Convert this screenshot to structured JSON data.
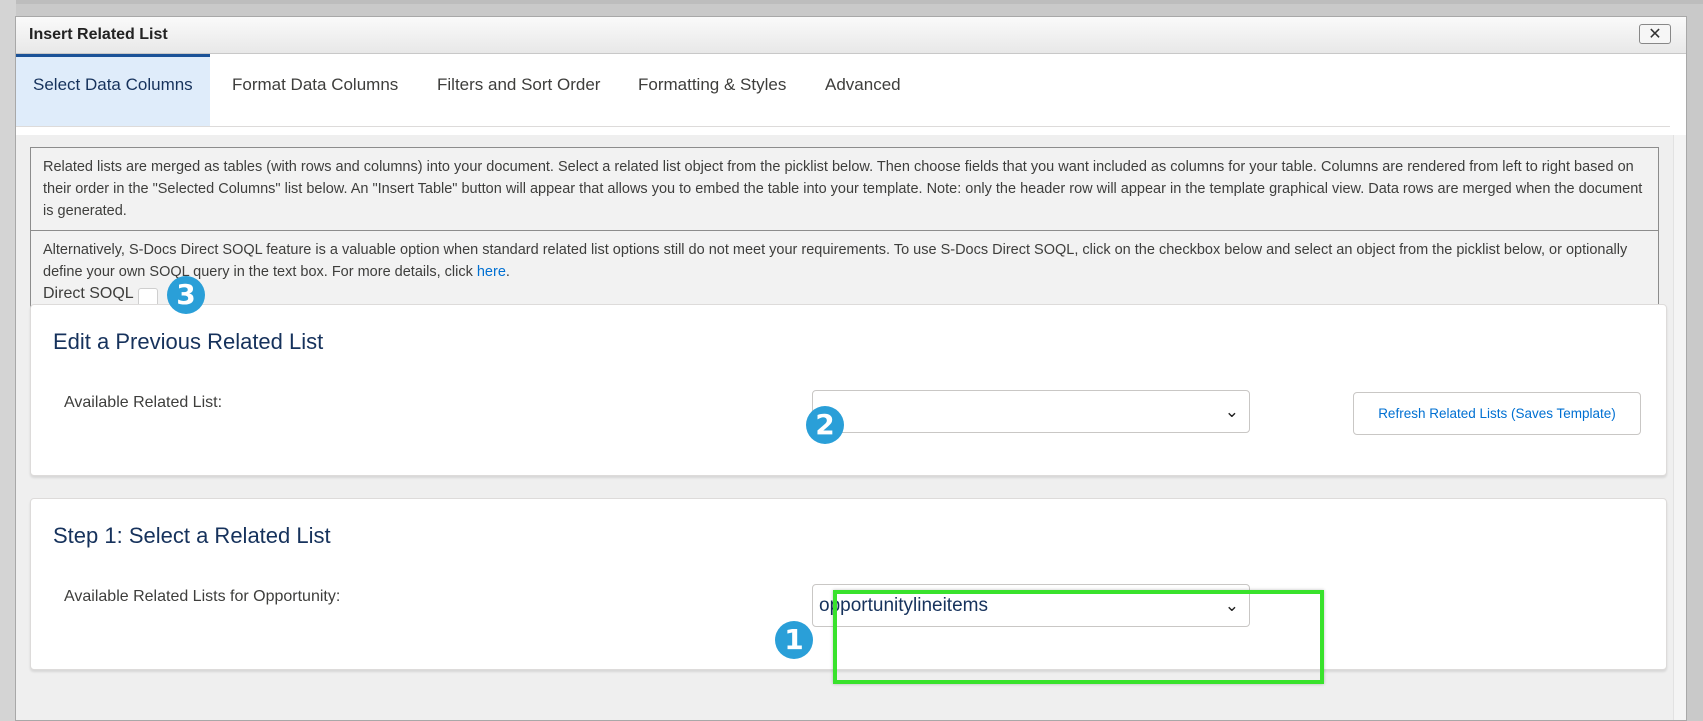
{
  "dialog": {
    "title": "Insert Related List",
    "close_glyph": "✕"
  },
  "tabs": [
    {
      "label": "Select Data Columns",
      "active": true
    },
    {
      "label": "Format Data Columns",
      "active": false
    },
    {
      "label": "Filters and Sort Order",
      "active": false
    },
    {
      "label": "Formatting & Styles",
      "active": false
    },
    {
      "label": "Advanced",
      "active": false
    }
  ],
  "info": {
    "paragraph1": "Related lists are merged as tables (with rows and columns) into your document. Select a related list object from the picklist below. Then choose fields that you want included as columns for your table. Columns are rendered from left to right based on their order in the \"Selected Columns\" list below. An \"Insert Table\" button will appear that allows you to embed the table into your template. Note: only the header row will appear in the template graphical view. Data rows are merged when the document is generated.",
    "paragraph2": "Alternatively, S-Docs Direct SOQL feature is a valuable option when standard related list options still do not meet your requirements. To use S-Docs Direct SOQL, click on the checkbox below and select an object from the picklist below, or optionally define your own SOQL query in the text box. For more details, click",
    "link_text": "here",
    "link_suffix": ".",
    "direct_soql_label": "Direct SOQL",
    "direct_soql_checked": false
  },
  "edit_previous": {
    "title": "Edit a Previous Related List",
    "label": "Available Related List:",
    "selected_value": "",
    "refresh_button": "Refresh Related Lists (Saves Template)"
  },
  "step1": {
    "title": "Step 1: Select a Related List",
    "label": "Available Related Lists for Opportunity:",
    "selected_value": "opportunitylineitems"
  },
  "badges": {
    "one": "1",
    "two": "2",
    "three": "3"
  },
  "icons": {
    "dropdown": "chevron-down-icon",
    "close": "close-icon"
  },
  "colors": {
    "accent": "#1b5297",
    "active_tab_bg": "#dfecfa",
    "badge": "#2a9fd8",
    "highlight": "#39e22c",
    "link": "#0070d2",
    "heading": "#16325c"
  }
}
